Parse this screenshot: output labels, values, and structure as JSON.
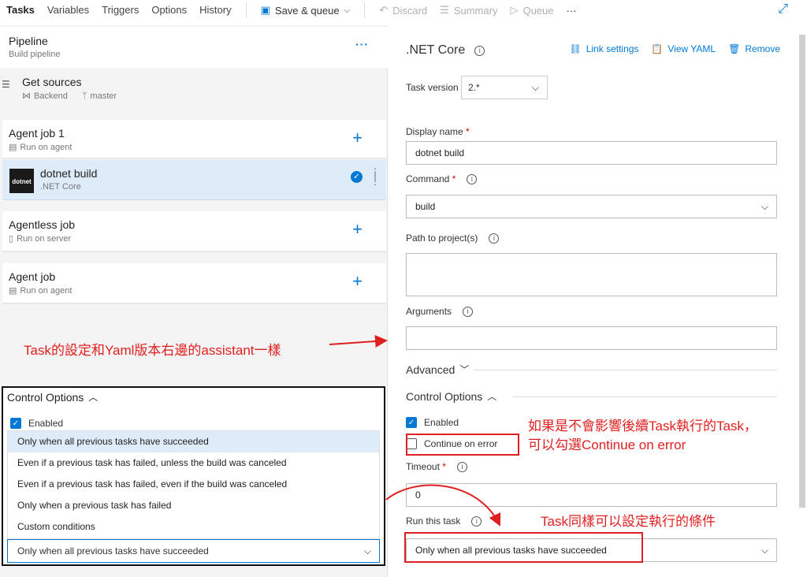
{
  "topbar": {
    "tabs": [
      "Tasks",
      "Variables",
      "Triggers",
      "Options",
      "History"
    ],
    "save_queue": "Save & queue",
    "discard": "Discard",
    "summary": "Summary",
    "queue": "Queue",
    "more": "···"
  },
  "left": {
    "pipeline_title": "Pipeline",
    "pipeline_sub": "Build pipeline",
    "get_sources": "Get sources",
    "get_sources_repo": "Backend",
    "get_sources_branch": "master",
    "agent_job_1": "Agent job 1",
    "agent_job_1_sub": "Run on agent",
    "task_name": "dotnet build",
    "task_sub": ".NET Core",
    "task_logo": "dotnet",
    "agentless_job": "Agentless job",
    "agentless_sub": "Run on server",
    "agent_job": "Agent job",
    "agent_job_sub": "Run on agent"
  },
  "annotations": {
    "left_note": "Task的設定和Yaml版本右邊的assistant一樣",
    "continue_note_1": "如果是不會影響後續Task執行的Task，",
    "continue_note_2": "可以勾選Continue on error",
    "condition_note": "Task同樣可以設定執行的條件"
  },
  "control_box": {
    "header": "Control Options",
    "enabled": "Enabled",
    "options": [
      "Only when all previous tasks have succeeded",
      "Even if a previous task has failed, unless the build was canceled",
      "Even if a previous task has failed, even if the build was canceled",
      "Only when a previous task has failed",
      "Custom conditions"
    ],
    "selected": "Only when all previous tasks have succeeded"
  },
  "right": {
    "title": ".NET Core",
    "link_settings": "Link settings",
    "view_yaml": "View YAML",
    "remove": "Remove",
    "task_version_label": "Task version",
    "task_version": "2.*",
    "display_name_label": "Display name",
    "display_name": "dotnet build",
    "command_label": "Command",
    "command": "build",
    "path_label": "Path to project(s)",
    "arguments_label": "Arguments",
    "advanced": "Advanced",
    "control_options": "Control Options",
    "enabled": "Enabled",
    "continue_on_error": "Continue on error",
    "timeout_label": "Timeout",
    "timeout": "0",
    "run_this_task_label": "Run this task",
    "run_this_task": "Only when all previous tasks have succeeded",
    "required_mark": "*"
  },
  "colors": {
    "accent": "#0078d4",
    "annotation": "#e02020"
  }
}
